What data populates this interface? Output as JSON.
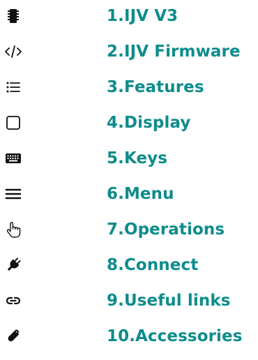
{
  "colors": {
    "accent": "#0e8c8c",
    "icon": "#111111"
  },
  "nav": {
    "items": [
      {
        "label": "1.IJV V3",
        "icon": "chip-icon"
      },
      {
        "label": "2.IJV Firmware",
        "icon": "code-icon"
      },
      {
        "label": "3.Features",
        "icon": "list-icon"
      },
      {
        "label": "4.Display",
        "icon": "square-icon"
      },
      {
        "label": "5.Keys",
        "icon": "keyboard-icon"
      },
      {
        "label": "6.Menu",
        "icon": "menu-icon"
      },
      {
        "label": "7.Operations",
        "icon": "pointer-hand-icon"
      },
      {
        "label": "8.Connect",
        "icon": "plug-icon"
      },
      {
        "label": "9.Useful links",
        "icon": "link-icon"
      },
      {
        "label": "10.Accessories",
        "icon": "paperclip-icon"
      }
    ]
  }
}
